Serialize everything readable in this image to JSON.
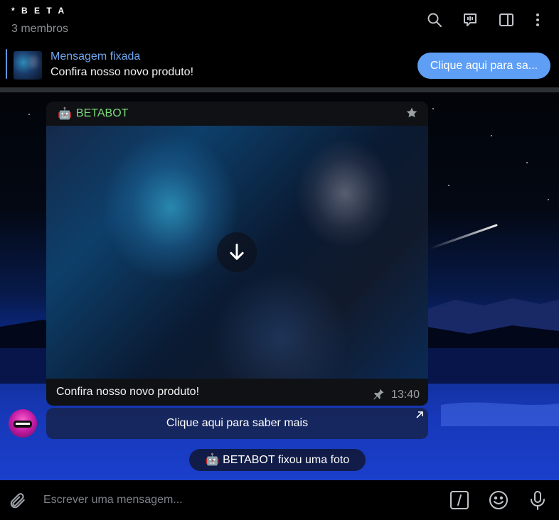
{
  "header": {
    "title": "* B E T A",
    "subtitle": "3 membros",
    "icons": [
      "search-icon",
      "voice-chat-icon",
      "sidebar-toggle-icon",
      "more-icon"
    ]
  },
  "pinned": {
    "title": "Mensagem fixada",
    "text": "Confira nosso novo produto!",
    "button_label": "Clique aqui para sa..."
  },
  "message": {
    "sender_emoji": "🤖",
    "sender": "BETABOT",
    "caption": "Confira nosso novo produto!",
    "time": "13:40",
    "inline_button": "Clique aqui para saber mais"
  },
  "service_message": "🤖 BETABOT fixou uma foto",
  "composer": {
    "placeholder": "Escrever uma mensagem..."
  },
  "colors": {
    "accent": "#5e9ef5",
    "pinned_title": "#6fa6f0",
    "sender": "#7ddc7a"
  }
}
